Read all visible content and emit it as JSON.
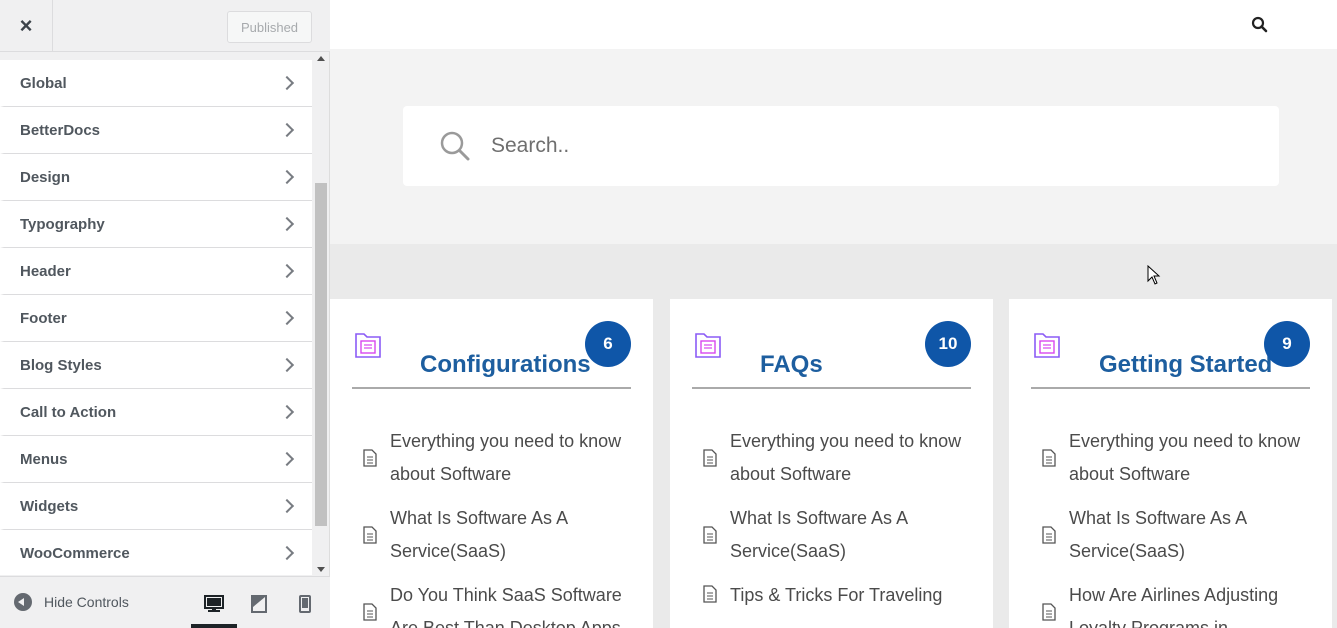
{
  "sidebar": {
    "close_label": "×",
    "published_label": "Published",
    "items": [
      {
        "label": "Global"
      },
      {
        "label": "BetterDocs"
      },
      {
        "label": "Design"
      },
      {
        "label": "Typography"
      },
      {
        "label": "Header"
      },
      {
        "label": "Footer"
      },
      {
        "label": "Blog Styles"
      },
      {
        "label": "Call to Action"
      },
      {
        "label": "Menus"
      },
      {
        "label": "Widgets"
      },
      {
        "label": "WooCommerce"
      }
    ],
    "hide_controls_label": "Hide Controls",
    "active_device": "desktop"
  },
  "preview": {
    "search_placeholder": "Search..",
    "cards": [
      {
        "title": "Configurations",
        "count": "6",
        "docs": [
          "Everything you need to know about Software",
          "What Is Software As A Service(SaaS)",
          "Do You Think SaaS Software Are Best Than Desktop Apps"
        ]
      },
      {
        "title": "FAQs",
        "count": "10",
        "docs": [
          "Everything you need to know about Software",
          "What Is Software As A Service(SaaS)",
          "Tips & Tricks For Traveling"
        ]
      },
      {
        "title": "Getting Started",
        "count": "9",
        "docs": [
          "Everything you need to know about Software",
          "What Is Software As A Service(SaaS)",
          "How Are Airlines Adjusting Loyalty Programs in"
        ]
      }
    ]
  },
  "colors": {
    "accent": "#0f56a8",
    "card_title": "#1d5e9f",
    "icon_purple": "#8b5cf6"
  }
}
